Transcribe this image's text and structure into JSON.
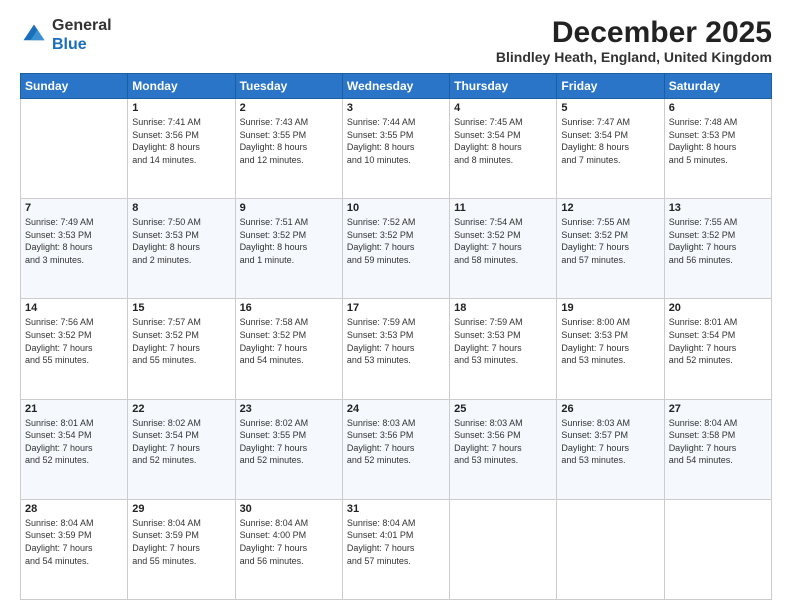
{
  "logo": {
    "general": "General",
    "blue": "Blue"
  },
  "header": {
    "month": "December 2025",
    "location": "Blindley Heath, England, United Kingdom"
  },
  "weekdays": [
    "Sunday",
    "Monday",
    "Tuesday",
    "Wednesday",
    "Thursday",
    "Friday",
    "Saturday"
  ],
  "weeks": [
    [
      {
        "day": "",
        "info": ""
      },
      {
        "day": "1",
        "info": "Sunrise: 7:41 AM\nSunset: 3:56 PM\nDaylight: 8 hours\nand 14 minutes."
      },
      {
        "day": "2",
        "info": "Sunrise: 7:43 AM\nSunset: 3:55 PM\nDaylight: 8 hours\nand 12 minutes."
      },
      {
        "day": "3",
        "info": "Sunrise: 7:44 AM\nSunset: 3:55 PM\nDaylight: 8 hours\nand 10 minutes."
      },
      {
        "day": "4",
        "info": "Sunrise: 7:45 AM\nSunset: 3:54 PM\nDaylight: 8 hours\nand 8 minutes."
      },
      {
        "day": "5",
        "info": "Sunrise: 7:47 AM\nSunset: 3:54 PM\nDaylight: 8 hours\nand 7 minutes."
      },
      {
        "day": "6",
        "info": "Sunrise: 7:48 AM\nSunset: 3:53 PM\nDaylight: 8 hours\nand 5 minutes."
      }
    ],
    [
      {
        "day": "7",
        "info": "Sunrise: 7:49 AM\nSunset: 3:53 PM\nDaylight: 8 hours\nand 3 minutes."
      },
      {
        "day": "8",
        "info": "Sunrise: 7:50 AM\nSunset: 3:53 PM\nDaylight: 8 hours\nand 2 minutes."
      },
      {
        "day": "9",
        "info": "Sunrise: 7:51 AM\nSunset: 3:52 PM\nDaylight: 8 hours\nand 1 minute."
      },
      {
        "day": "10",
        "info": "Sunrise: 7:52 AM\nSunset: 3:52 PM\nDaylight: 7 hours\nand 59 minutes."
      },
      {
        "day": "11",
        "info": "Sunrise: 7:54 AM\nSunset: 3:52 PM\nDaylight: 7 hours\nand 58 minutes."
      },
      {
        "day": "12",
        "info": "Sunrise: 7:55 AM\nSunset: 3:52 PM\nDaylight: 7 hours\nand 57 minutes."
      },
      {
        "day": "13",
        "info": "Sunrise: 7:55 AM\nSunset: 3:52 PM\nDaylight: 7 hours\nand 56 minutes."
      }
    ],
    [
      {
        "day": "14",
        "info": "Sunrise: 7:56 AM\nSunset: 3:52 PM\nDaylight: 7 hours\nand 55 minutes."
      },
      {
        "day": "15",
        "info": "Sunrise: 7:57 AM\nSunset: 3:52 PM\nDaylight: 7 hours\nand 55 minutes."
      },
      {
        "day": "16",
        "info": "Sunrise: 7:58 AM\nSunset: 3:52 PM\nDaylight: 7 hours\nand 54 minutes."
      },
      {
        "day": "17",
        "info": "Sunrise: 7:59 AM\nSunset: 3:53 PM\nDaylight: 7 hours\nand 53 minutes."
      },
      {
        "day": "18",
        "info": "Sunrise: 7:59 AM\nSunset: 3:53 PM\nDaylight: 7 hours\nand 53 minutes."
      },
      {
        "day": "19",
        "info": "Sunrise: 8:00 AM\nSunset: 3:53 PM\nDaylight: 7 hours\nand 53 minutes."
      },
      {
        "day": "20",
        "info": "Sunrise: 8:01 AM\nSunset: 3:54 PM\nDaylight: 7 hours\nand 52 minutes."
      }
    ],
    [
      {
        "day": "21",
        "info": "Sunrise: 8:01 AM\nSunset: 3:54 PM\nDaylight: 7 hours\nand 52 minutes."
      },
      {
        "day": "22",
        "info": "Sunrise: 8:02 AM\nSunset: 3:54 PM\nDaylight: 7 hours\nand 52 minutes."
      },
      {
        "day": "23",
        "info": "Sunrise: 8:02 AM\nSunset: 3:55 PM\nDaylight: 7 hours\nand 52 minutes."
      },
      {
        "day": "24",
        "info": "Sunrise: 8:03 AM\nSunset: 3:56 PM\nDaylight: 7 hours\nand 52 minutes."
      },
      {
        "day": "25",
        "info": "Sunrise: 8:03 AM\nSunset: 3:56 PM\nDaylight: 7 hours\nand 53 minutes."
      },
      {
        "day": "26",
        "info": "Sunrise: 8:03 AM\nSunset: 3:57 PM\nDaylight: 7 hours\nand 53 minutes."
      },
      {
        "day": "27",
        "info": "Sunrise: 8:04 AM\nSunset: 3:58 PM\nDaylight: 7 hours\nand 54 minutes."
      }
    ],
    [
      {
        "day": "28",
        "info": "Sunrise: 8:04 AM\nSunset: 3:59 PM\nDaylight: 7 hours\nand 54 minutes."
      },
      {
        "day": "29",
        "info": "Sunrise: 8:04 AM\nSunset: 3:59 PM\nDaylight: 7 hours\nand 55 minutes."
      },
      {
        "day": "30",
        "info": "Sunrise: 8:04 AM\nSunset: 4:00 PM\nDaylight: 7 hours\nand 56 minutes."
      },
      {
        "day": "31",
        "info": "Sunrise: 8:04 AM\nSunset: 4:01 PM\nDaylight: 7 hours\nand 57 minutes."
      },
      {
        "day": "",
        "info": ""
      },
      {
        "day": "",
        "info": ""
      },
      {
        "day": "",
        "info": ""
      }
    ]
  ]
}
